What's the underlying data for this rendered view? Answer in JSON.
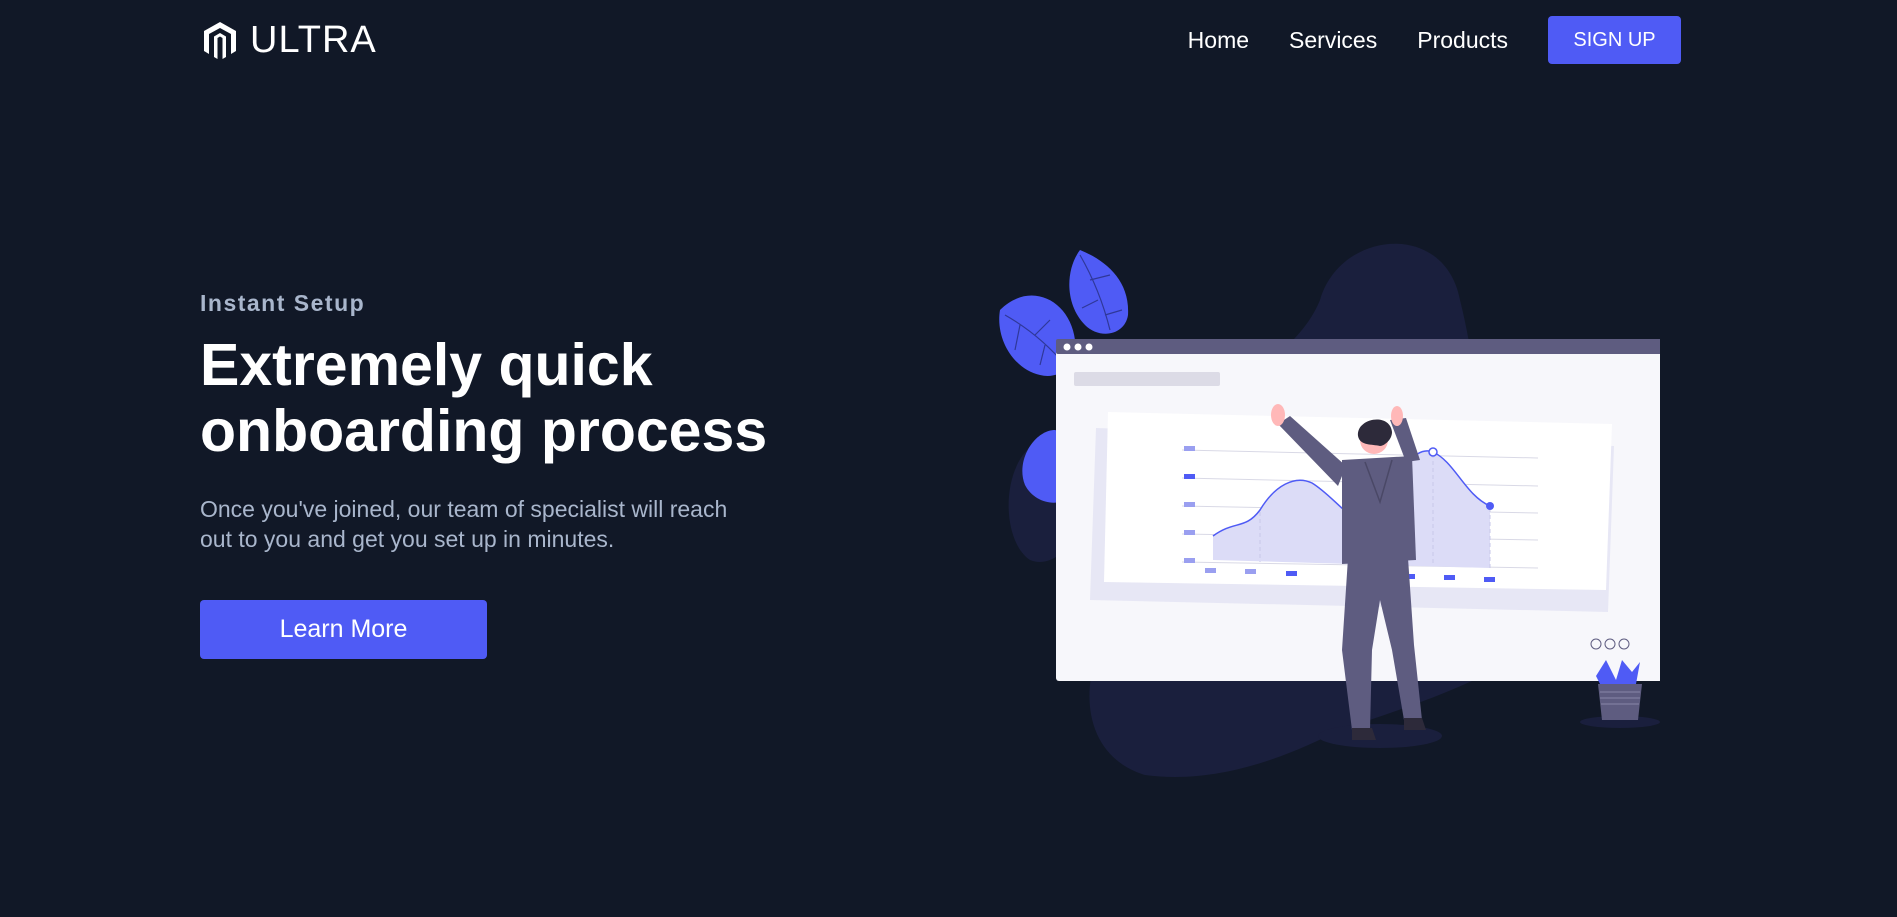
{
  "nav": {
    "brand": "ULTRA",
    "links": [
      "Home",
      "Services",
      "Products"
    ],
    "signup_label": "SIGN UP"
  },
  "hero": {
    "eyebrow": "Instant Setup",
    "title": "Extremely quick onboarding process",
    "subtitle": "Once you've joined, our team of specialist will reach out to you and get you set up in minutes.",
    "cta_label": "Learn More"
  },
  "colors": {
    "background": "#111827",
    "accent": "#4f5bf5",
    "muted_text": "#a9b6cc",
    "blob": "#1a1f3d",
    "figure": "#5e5c80"
  },
  "icons": [
    "ultra-logo-icon"
  ]
}
